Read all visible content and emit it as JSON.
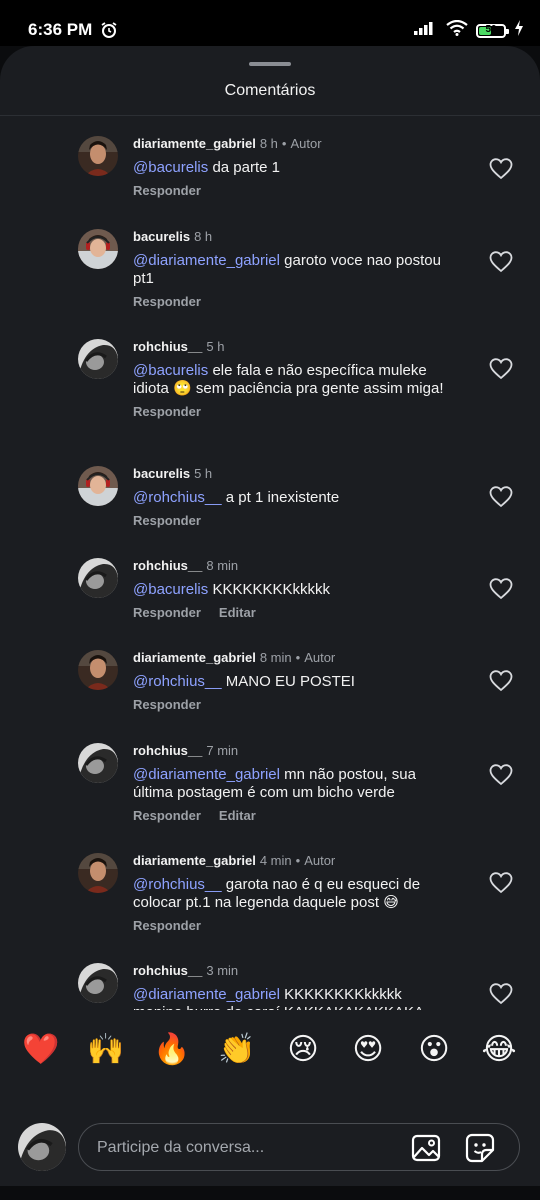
{
  "status": {
    "time": "6:36 PM",
    "battery": "50",
    "battery_level": 0.5
  },
  "sheet": {
    "title": "Comentários"
  },
  "comments": [
    {
      "user": "diariamente_gabriel",
      "time": "8 h",
      "badge": "Autor",
      "mention": "@bacurelis",
      "text": "da parte 1",
      "reply": "Responder",
      "edit": "",
      "avatar": "gabriel"
    },
    {
      "user": "bacurelis",
      "time": "8 h",
      "badge": "",
      "mention": "@diariamente_gabriel",
      "text": "garoto voce nao postou pt1",
      "reply": "Responder",
      "edit": "",
      "avatar": "bacurelis"
    },
    {
      "user": "rohchius__",
      "time": "5 h",
      "badge": "",
      "mention": "@bacurelis",
      "text": "ele fala e não específica muleke idiota 🙄 sem paciência pra gente assim miga!",
      "reply": "Responder",
      "edit": "",
      "avatar": "rohchius"
    },
    {
      "user": "bacurelis",
      "time": "5 h",
      "badge": "",
      "mention": "@rohchius__",
      "text": "a pt 1 inexistente",
      "reply": "Responder",
      "edit": "",
      "avatar": "bacurelis"
    },
    {
      "user": "rohchius__",
      "time": "8 min",
      "badge": "",
      "mention": "@bacurelis",
      "text": "KKKKKKKKkkkkk",
      "reply": "Responder",
      "edit": "Editar",
      "avatar": "rohchius"
    },
    {
      "user": "diariamente_gabriel",
      "time": "8 min",
      "badge": "Autor",
      "mention": "@rohchius__",
      "text": "MANO EU POSTEI",
      "reply": "Responder",
      "edit": "",
      "avatar": "gabriel"
    },
    {
      "user": "rohchius__",
      "time": "7 min",
      "badge": "",
      "mention": "@diariamente_gabriel",
      "text": "mn não postou, sua última postagem é com um bicho verde",
      "reply": "Responder",
      "edit": "Editar",
      "avatar": "rohchius"
    },
    {
      "user": "diariamente_gabriel",
      "time": "4 min",
      "badge": "Autor",
      "mention": "@rohchius__",
      "text": "garota nao é q eu esqueci de colocar pt.1 na legenda daquele post 😅",
      "reply": "Responder",
      "edit": "",
      "avatar": "gabriel"
    },
    {
      "user": "rohchius__",
      "time": "3 min",
      "badge": "",
      "mention": "@diariamente_gabriel",
      "text": "KKKKKKKKkkkkk menino burro do caraí KAKKAKAKAKKAKA agora eu ri em meuuu 🤣🤣🤣🤣🤣😂😂😂😂😂😅😅😅😅",
      "reply": "",
      "edit": "",
      "avatar": "rohchius"
    }
  ],
  "emoji_bar": [
    "❤️",
    "🙌",
    "🔥",
    "👏",
    "😢",
    "😍",
    "😮",
    "😂"
  ],
  "composer": {
    "placeholder": "Participe da conversa..."
  },
  "icons": {
    "like": "heart-outline-icon",
    "image": "image-icon",
    "sticker": "sticker-icon",
    "alarm": "alarm-icon",
    "signal": "signal-icon",
    "wifi": "wifi-icon",
    "battery": "battery-icon",
    "charging": "charging-icon"
  },
  "colors": {
    "mention": "#8ea2ff",
    "sheet_bg": "#1b1d21",
    "secondary_text": "#9da1a7"
  }
}
